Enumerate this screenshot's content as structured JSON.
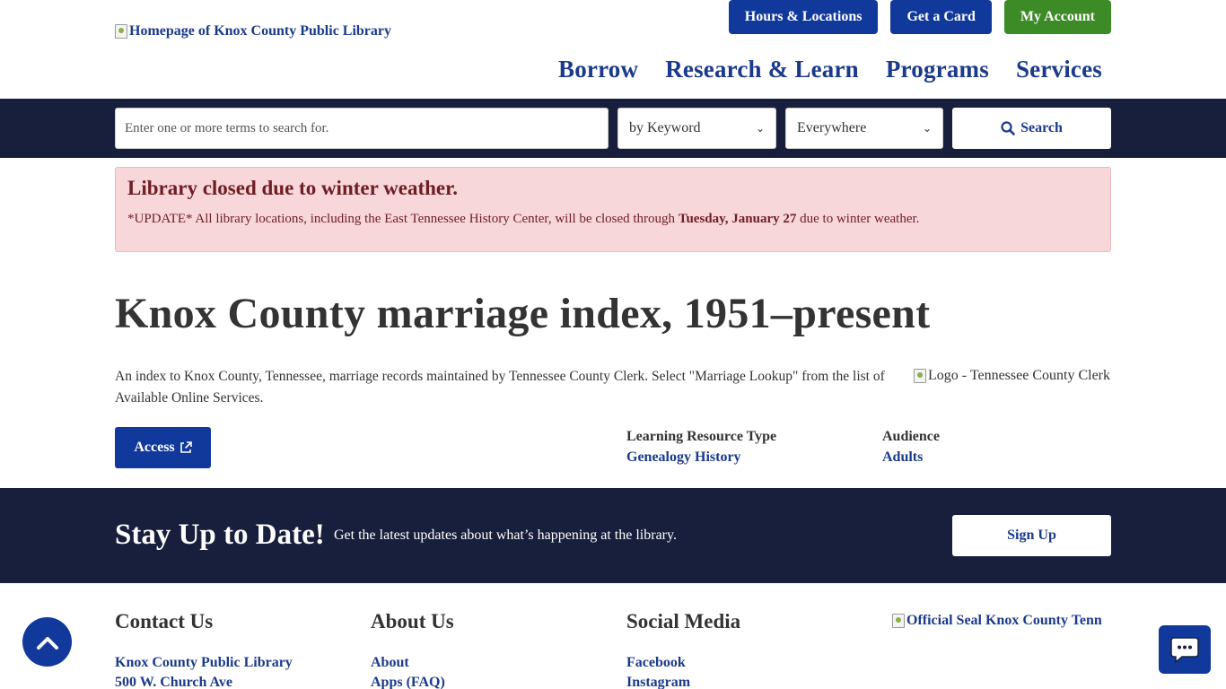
{
  "header": {
    "logo_alt": "Homepage of Knox County Public Library",
    "top_buttons": [
      "Hours & Locations",
      "Get a Card",
      "My Account"
    ],
    "nav": [
      "Borrow",
      "Research & Learn",
      "Programs",
      "Services"
    ]
  },
  "search": {
    "placeholder": "Enter one or more terms to search for.",
    "type_selected": "by Keyword",
    "scope_selected": "Everywhere",
    "button_label": "Search"
  },
  "alert": {
    "title": "Library closed due to winter weather.",
    "body_prefix": "*UPDATE* All library locations, including the East Tennessee History Center, will be closed through ",
    "body_bold": "Tuesday, January 27",
    "body_suffix": " due to winter weather."
  },
  "main": {
    "title": "Knox County marriage index, 1951–present",
    "description": "An index to Knox County, Tennessee, marriage records maintained by Tennessee County Clerk. Select \"Marriage Lookup\" from the list of Available Online Services.",
    "clerk_logo_alt": "Logo - Tennessee County Clerk",
    "access_label": "Access",
    "resource_type_label": "Learning Resource Type",
    "resource_type_value": "Genealogy History",
    "audience_label": "Audience",
    "audience_value": "Adults"
  },
  "newsletter": {
    "title": "Stay Up to Date!",
    "text": "Get the latest updates about what’s happening at the library.",
    "button_label": "Sign Up"
  },
  "footer": {
    "contact": {
      "title": "Contact Us",
      "lines": [
        "Knox County Public Library",
        "500 W. Church Ave"
      ]
    },
    "about": {
      "title": "About Us",
      "links": [
        "About",
        "Apps (FAQ)"
      ]
    },
    "social": {
      "title": "Social Media",
      "links": [
        "Facebook",
        "Instagram"
      ]
    },
    "seal_alt": "Official Seal Knox County Tenn"
  },
  "colors": {
    "navy": "#171f3d",
    "blue": "#11399c",
    "green": "#3c8b26",
    "alert_bg": "#f8d7da"
  }
}
